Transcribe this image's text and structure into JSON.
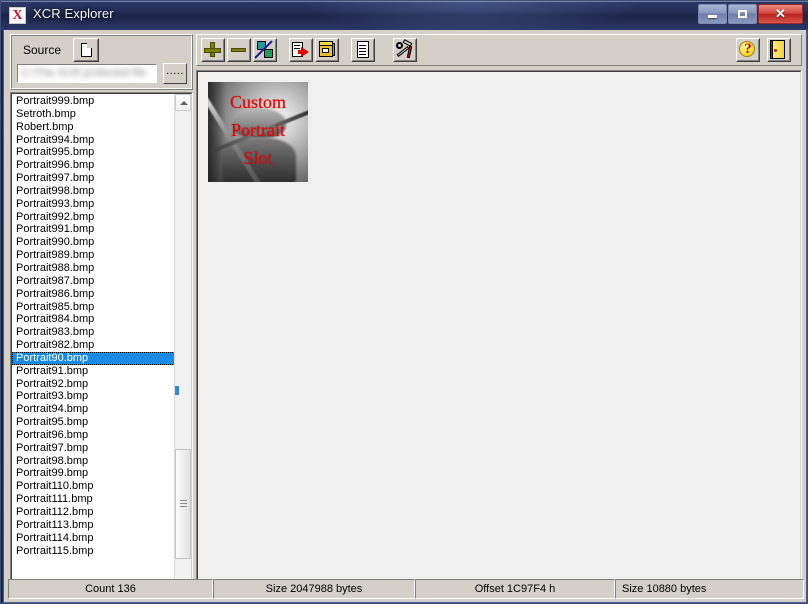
{
  "window": {
    "title": "XCR Explorer",
    "icon": "X",
    "controls": {
      "minimize": "minimize",
      "maximize": "maximize",
      "close": "✕"
    }
  },
  "source_panel": {
    "label": "Source",
    "file_button_icon": "document-icon",
    "path_value": "C:\\The XCR protected file",
    "browse_label": "....."
  },
  "toolbar": {
    "buttons": [
      {
        "name": "add",
        "icon": "plus-icon",
        "tooltip": "Add"
      },
      {
        "name": "remove",
        "icon": "minus-icon",
        "tooltip": "Remove"
      },
      {
        "name": "replace",
        "icon": "swap-icon",
        "tooltip": "Replace"
      },
      {
        "name": "export",
        "icon": "export-icon",
        "tooltip": "Export"
      },
      {
        "name": "package",
        "icon": "package-icon",
        "tooltip": "Package"
      },
      {
        "name": "info",
        "icon": "document-icon",
        "tooltip": "Info"
      },
      {
        "name": "tools",
        "icon": "tools-icon",
        "tooltip": "Tools"
      }
    ],
    "right_buttons": [
      {
        "name": "help",
        "icon": "help-icon",
        "tooltip": "Help"
      },
      {
        "name": "exit",
        "icon": "exit-door-icon",
        "tooltip": "Exit"
      }
    ]
  },
  "file_list": {
    "selected": "Portrait90.bmp",
    "items": [
      "Portrait999.bmp",
      "Setroth.bmp",
      "Robert.bmp",
      "Portrait994.bmp",
      "Portrait995.bmp",
      "Portrait996.bmp",
      "Portrait997.bmp",
      "Portrait998.bmp",
      "Portrait993.bmp",
      "Portrait992.bmp",
      "Portrait991.bmp",
      "Portrait990.bmp",
      "Portrait989.bmp",
      "Portrait988.bmp",
      "Portrait987.bmp",
      "Portrait986.bmp",
      "Portrait985.bmp",
      "Portrait984.bmp",
      "Portrait983.bmp",
      "Portrait982.bmp",
      "Portrait90.bmp",
      "Portrait91.bmp",
      "Portrait92.bmp",
      "Portrait93.bmp",
      "Portrait94.bmp",
      "Portrait95.bmp",
      "Portrait96.bmp",
      "Portrait97.bmp",
      "Portrait98.bmp",
      "Portrait99.bmp",
      "Portrait110.bmp",
      "Portrait111.bmp",
      "Portrait112.bmp",
      "Portrait113.bmp",
      "Portrait114.bmp",
      "Portrait115.bmp"
    ]
  },
  "preview": {
    "caption_lines": [
      "Custom",
      "Portrait",
      "Slot"
    ],
    "alt": "grayscale warrior portrait with red caption"
  },
  "status": {
    "count": "Count 136",
    "total_size": "Size 2047988 bytes",
    "offset": "Offset 1C97F4 h",
    "entry_size": "Size 10880 bytes"
  },
  "colors": {
    "selection": "#1a8ae5",
    "caption_red": "#ee0000",
    "title_bar": "#1c2547",
    "dialog_face": "#d4d0c8"
  }
}
